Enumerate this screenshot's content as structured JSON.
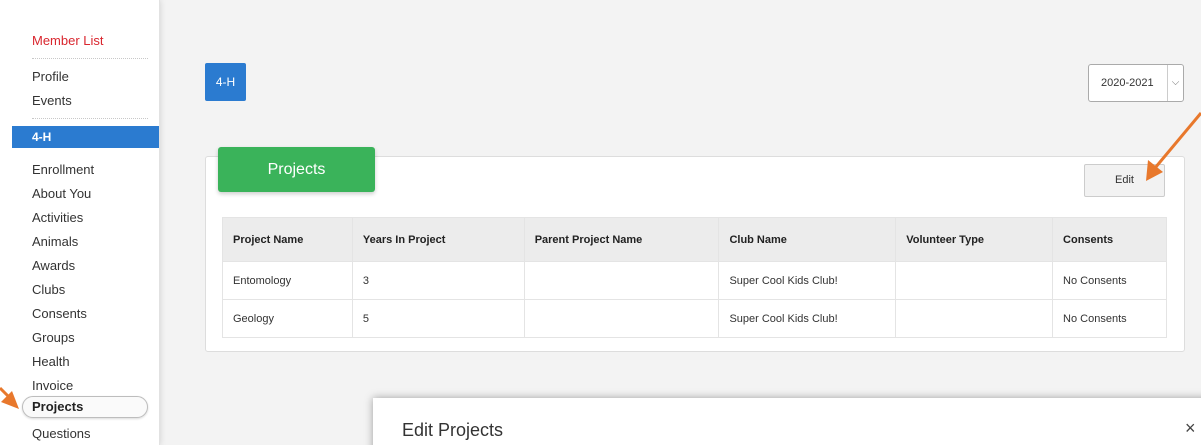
{
  "sidebar": {
    "member_list": "Member List",
    "profile": "Profile",
    "events": "Events",
    "section": "4-H",
    "items": [
      "Enrollment",
      "About You",
      "Activities",
      "Animals",
      "Awards",
      "Clubs",
      "Consents",
      "Groups",
      "Health",
      "Invoice"
    ],
    "projects": "Projects",
    "questions": "Questions"
  },
  "program_badge": "4-H",
  "year_select": {
    "value": "2020-2021"
  },
  "card": {
    "title": "Projects",
    "edit_label": "Edit"
  },
  "table": {
    "headers": [
      "Project Name",
      "Years In Project",
      "Parent Project Name",
      "Club Name",
      "Volunteer Type",
      "Consents"
    ],
    "rows": [
      [
        "Entomology",
        "3",
        "",
        "Super Cool Kids Club!",
        "",
        "No Consents"
      ],
      [
        "Geology",
        "5",
        "",
        "Super Cool Kids Club!",
        "",
        "No Consents"
      ]
    ]
  },
  "modal": {
    "title": "Edit Projects",
    "close": "×"
  },
  "colors": {
    "accent_blue": "#2b7bd0",
    "title_green": "#3ab35a",
    "member_red": "#d9262e",
    "arrow_orange": "#e8782c"
  }
}
